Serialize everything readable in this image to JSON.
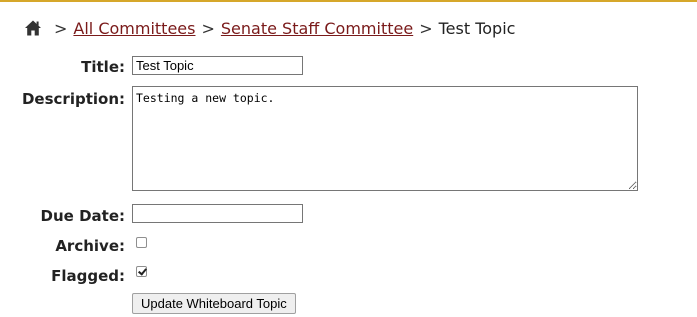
{
  "breadcrumb": {
    "home_icon": "home-icon",
    "separator": ">",
    "items": [
      {
        "label": "All Committees"
      },
      {
        "label": "Senate Staff Committee"
      }
    ],
    "current": "Test Topic"
  },
  "form": {
    "title_label": "Title:",
    "title_value": "Test Topic",
    "description_label": "Description:",
    "description_value": "Testing a new topic.",
    "due_date_label": "Due Date:",
    "due_date_value": "",
    "archive_label": "Archive:",
    "archive_checked": false,
    "flagged_label": "Flagged:",
    "flagged_checked": true,
    "submit_label": "Update Whiteboard Topic"
  },
  "colors": {
    "accent_rule": "#d6a72a",
    "link": "#7a1a1a"
  }
}
